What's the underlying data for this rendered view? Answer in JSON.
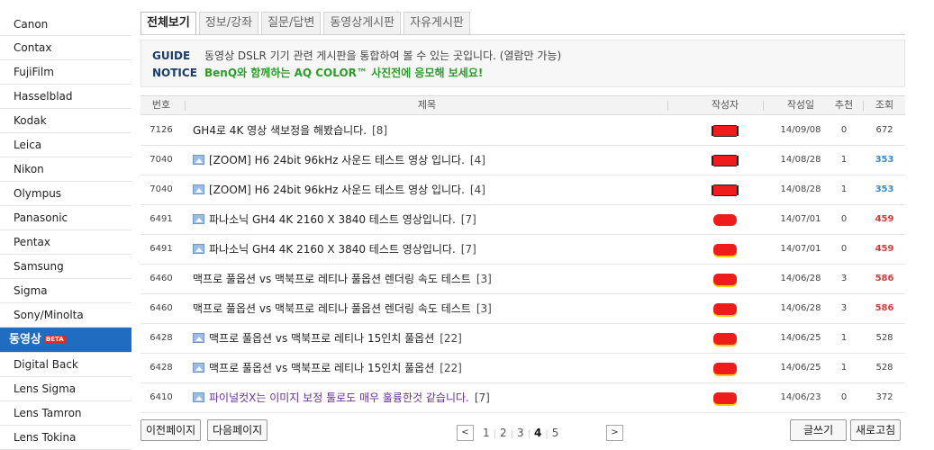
{
  "sidebar": {
    "items": [
      "Canon",
      "Contax",
      "FujiFilm",
      "Hasselblad",
      "Kodak",
      "Leica",
      "Nikon",
      "Olympus",
      "Panasonic",
      "Pentax",
      "Samsung",
      "Sigma",
      "Sony/Minolta"
    ],
    "active": {
      "label": "동영상",
      "badge": "BETA"
    },
    "items_after": [
      "Digital Back",
      "Lens Sigma",
      "Lens Tamron",
      "Lens Tokina"
    ]
  },
  "tabs": [
    "전체보기",
    "정보/강좌",
    "질문/답변",
    "동영상게시판",
    "자유게시판"
  ],
  "notice": {
    "guide_label": "GUIDE",
    "guide_text": "동영상 DSLR 기기 관련 게시판을 통합하여 볼 수 있는 곳입니다. (열람만 가능)",
    "notice_label": "NOTICE",
    "notice_text": "BenQ와 함께하는 AQ COLOR™ 사진전에 응모해 보세요!"
  },
  "table": {
    "headers": {
      "no": "번호",
      "title": "제목",
      "author": "작성자",
      "date": "작성일",
      "rec": "추천",
      "views": "조회"
    },
    "rows": [
      {
        "no": "7126",
        "title": "GH4로 4K 영상 색보정을 해봤습니다.",
        "comments": "[8]",
        "image": false,
        "date": "14/09/08",
        "rec": "0",
        "views": "672"
      },
      {
        "no": "7040",
        "title": "[ZOOM] H6 24bit 96kHz 사운드 테스트 영상 입니다.",
        "comments": "[4]",
        "image": true,
        "date": "14/08/28",
        "rec": "1",
        "views": "353"
      },
      {
        "no": "7040",
        "title": "[ZOOM] H6 24bit 96kHz 사운드 테스트 영상 입니다.",
        "comments": "[4]",
        "image": true,
        "date": "14/08/28",
        "rec": "1",
        "views": "353"
      },
      {
        "no": "6491",
        "title": "파나소닉 GH4 4K 2160 X 3840 테스트 영상입니다.",
        "comments": "[7]",
        "image": true,
        "date": "14/07/01",
        "rec": "0",
        "views": "459"
      },
      {
        "no": "6491",
        "title": "파나소닉 GH4 4K 2160 X 3840 테스트 영상입니다.",
        "comments": "[7]",
        "image": true,
        "date": "14/07/01",
        "rec": "0",
        "views": "459"
      },
      {
        "no": "6460",
        "title": "맥프로 풀옵션 vs 맥북프로 레티나 풀옵션 렌더링 속도 테스트",
        "comments": "[3]",
        "image": false,
        "date": "14/06/28",
        "rec": "3",
        "views": "586"
      },
      {
        "no": "6460",
        "title": "맥프로 풀옵션 vs 맥북프로 레티나 풀옵션 렌더링 속도 테스트",
        "comments": "[3]",
        "image": false,
        "date": "14/06/28",
        "rec": "3",
        "views": "586"
      },
      {
        "no": "6428",
        "title": "맥프로 풀옵션 vs 맥북프로 레티나 15인치 풀옵션",
        "comments": "[22]",
        "image": true,
        "date": "14/06/25",
        "rec": "1",
        "views": "528"
      },
      {
        "no": "6428",
        "title": "맥프로 풀옵션 vs 맥북프로 레티나 15인치 풀옵션",
        "comments": "[22]",
        "image": true,
        "date": "14/06/25",
        "rec": "1",
        "views": "528"
      },
      {
        "no": "6410",
        "title": "파이널컷X는 이미지 보정 툴로도 매우 훌륭한것 같습니다.",
        "comments": "[7]",
        "image": true,
        "date": "14/06/23",
        "rec": "0",
        "views": "372"
      }
    ]
  },
  "buttons": {
    "prev_page": "이전페이지",
    "next_page": "다음페이지",
    "write": "글쓰기",
    "refresh": "새로고침"
  },
  "pagination": {
    "prev": "<",
    "next": ">",
    "pages": [
      "1",
      "2",
      "3",
      "4",
      "5"
    ],
    "current": "4"
  },
  "colors": {
    "active_sidebar": "#1f6cc1",
    "notice_green": "#2e9b2e",
    "views_blue": "#3e8ac7",
    "views_red": "#d43c3c",
    "visited_purple": "#6a2f9c"
  }
}
